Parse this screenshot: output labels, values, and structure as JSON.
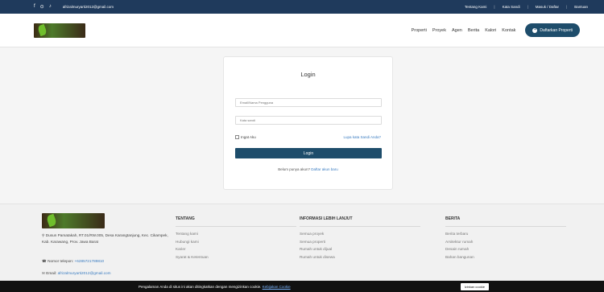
{
  "topbar": {
    "social": [
      "f",
      "⊙",
      "♪"
    ],
    "email": "afrizalmuryarti2012@gmail.com",
    "links": [
      "Tentang Kami",
      "Kata Sandi",
      "Masuk / Daftar",
      "Bantuan"
    ]
  },
  "nav": {
    "links": [
      "Properti",
      "Proyek",
      "Agen",
      "Berita",
      "Kalori",
      "Kontak"
    ],
    "cta": "Daftarkan Properti"
  },
  "login": {
    "title": "Login",
    "username_placeholder": "Email/Nama Pengguna",
    "password_placeholder": "Kata sandi",
    "remember": "Ingat Aku",
    "forgot": "Lupa kata Sandi Anda?",
    "submit": "Login",
    "register_prefix": "Belum punya akun?",
    "register_link": "Daftar akun baru"
  },
  "footer": {
    "address": "Dusun Pamatakah, RT.01/RW.005, Desa Karangtanjung, Kec. Cikampek, Kab. Karawang, Prov. Jawa Barat",
    "phone_label": "Nomor telepon:",
    "phone": "+6285721789810",
    "email_label": "Email:",
    "email": "afrizalmuryarti2012@gmail.com",
    "columns": [
      {
        "title": "TENTANG",
        "links": [
          "Tentang kami",
          "Hubungi kami",
          "Karier",
          "Syarat & Ketentuan"
        ]
      },
      {
        "title": "INFORMASI LEBIH LANJUT",
        "links": [
          "Semua proyek",
          "Semua properti",
          "Rumah untuk dijual",
          "Rumah untuk disewa"
        ]
      },
      {
        "title": "BERITA",
        "links": [
          "Berita terbaru",
          "Arsitektur rumah",
          "Desain rumah",
          "Bahan bangunan"
        ]
      }
    ]
  },
  "cookie": {
    "text": "Pengalaman Anda di situs ini akan ditingkatkan dengan mengizinkan cookie.",
    "link": "Kebijakan Cookie",
    "button": "Izinkan cookie"
  }
}
